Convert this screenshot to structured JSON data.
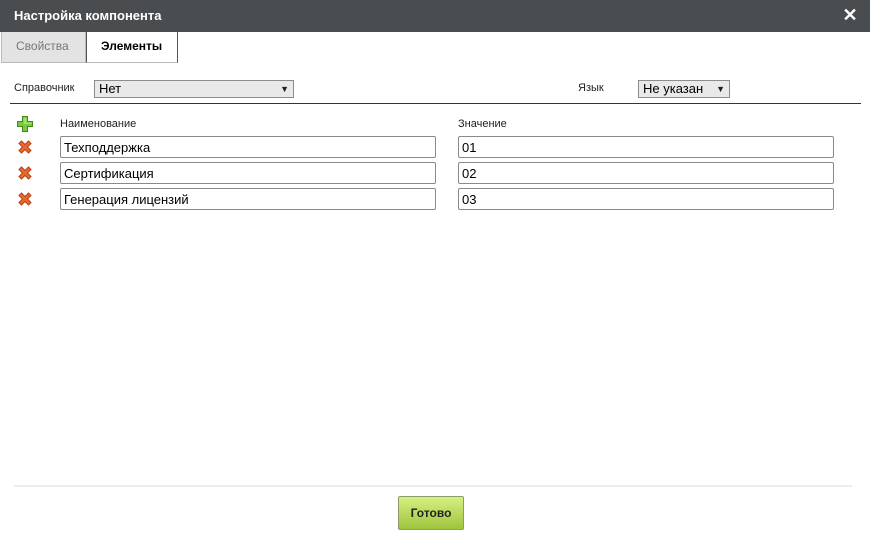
{
  "dialog": {
    "title": "Настройка компонента",
    "close_symbol": "✕"
  },
  "tabs": [
    {
      "label": "Свойства",
      "active": false
    },
    {
      "label": "Элементы",
      "active": true
    }
  ],
  "filters": {
    "directory_label": "Справочник",
    "directory_value": "Нет",
    "language_label": "Язык",
    "language_value": "Не указан"
  },
  "table": {
    "add_icon": "plus-icon",
    "delete_icon": "delete-x-icon",
    "headers": {
      "name": "Наименование",
      "value": "Значение"
    },
    "rows": [
      {
        "name": "Техподдержка",
        "value": "01"
      },
      {
        "name": "Сертификация",
        "value": "02"
      },
      {
        "name": "Генерация лицензий",
        "value": "03"
      }
    ]
  },
  "footer": {
    "done_label": "Готово"
  },
  "colors": {
    "titlebar": "#4a4d50",
    "done_button": "#b5d85a",
    "delete_icon": "#e0622a",
    "add_icon": "#6cc43a"
  }
}
